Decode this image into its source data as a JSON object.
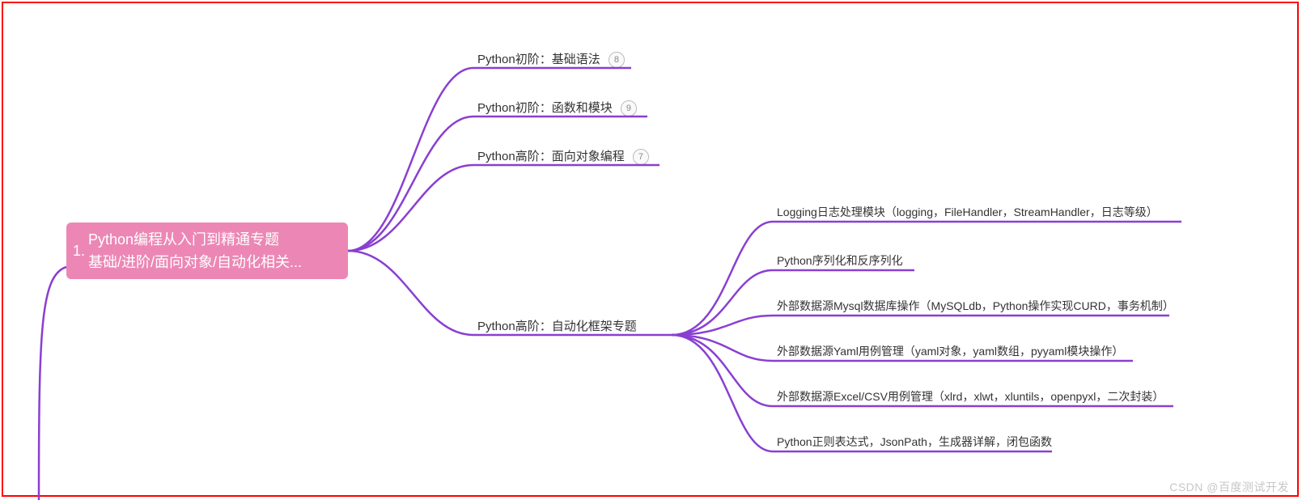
{
  "root": {
    "index": "1.",
    "line1": "Python编程从入门到精通专题",
    "line2": "基础/进阶/面向对象/自动化相关..."
  },
  "level1": [
    {
      "label": "Python初阶：基础语法",
      "badge": "8"
    },
    {
      "label": "Python初阶：函数和模块",
      "badge": "9"
    },
    {
      "label": "Python高阶：面向对象编程",
      "badge": "7"
    },
    {
      "label": "Python高阶：自动化框架专题",
      "badge": ""
    }
  ],
  "level2": [
    {
      "label": "Logging日志处理模块（logging，FileHandler，StreamHandler，日志等级）"
    },
    {
      "label": "Python序列化和反序列化"
    },
    {
      "label": "外部数据源Mysql数据库操作（MySQLdb，Python操作实现CURD，事务机制）"
    },
    {
      "label": "外部数据源Yaml用例管理（yaml对象，yaml数组，pyyaml模块操作）"
    },
    {
      "label": "外部数据源Excel/CSV用例管理（xlrd，xlwt，xluntils，openpyxl，二次封装）"
    },
    {
      "label": "Python正则表达式，JsonPath，生成器详解，闭包函数"
    }
  ],
  "watermark": "CSDN @百度测试开发"
}
